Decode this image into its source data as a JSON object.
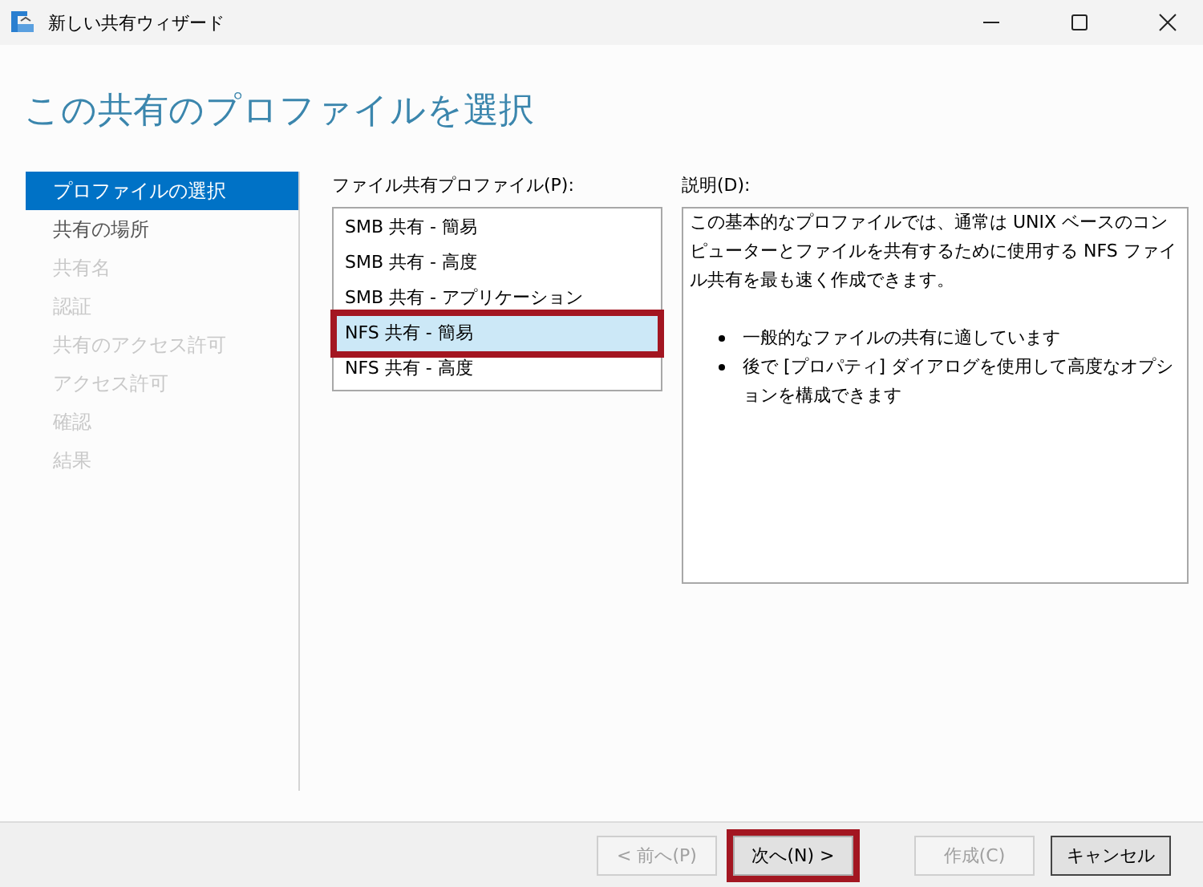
{
  "window": {
    "title": "新しい共有ウィザード"
  },
  "heading": "この共有のプロファイルを選択",
  "steps": [
    {
      "label": "プロファイルの選択",
      "selected": true,
      "disabled": false
    },
    {
      "label": "共有の場所",
      "selected": false,
      "disabled": false
    },
    {
      "label": "共有名",
      "selected": false,
      "disabled": true
    },
    {
      "label": "認証",
      "selected": false,
      "disabled": true
    },
    {
      "label": "共有のアクセス許可",
      "selected": false,
      "disabled": true
    },
    {
      "label": "アクセス許可",
      "selected": false,
      "disabled": true
    },
    {
      "label": "確認",
      "selected": false,
      "disabled": true
    },
    {
      "label": "結果",
      "selected": false,
      "disabled": true
    }
  ],
  "profiles": {
    "label": "ファイル共有プロファイル(P):",
    "items": [
      {
        "label": "SMB 共有 - 簡易",
        "selected": false,
        "highlighted": false
      },
      {
        "label": "SMB 共有 - 高度",
        "selected": false,
        "highlighted": false
      },
      {
        "label": "SMB 共有 - アプリケーション",
        "selected": false,
        "highlighted": false
      },
      {
        "label": "NFS 共有 - 簡易",
        "selected": true,
        "highlighted": true
      },
      {
        "label": "NFS 共有 - 高度",
        "selected": false,
        "highlighted": false
      }
    ]
  },
  "description": {
    "label": "説明(D):",
    "text": "この基本的なプロファイルでは、通常は UNIX ベースのコンピューターとファイルを共有するために使用する NFS ファイル共有を最も速く作成できます。",
    "bullets": [
      "一般的なファイルの共有に適しています",
      "後で [プロパティ] ダイアログを使用して高度なオプションを構成できます"
    ]
  },
  "buttons": [
    {
      "label": "< 前へ(P)",
      "disabled": true,
      "default": false,
      "highlighted": false
    },
    {
      "label": "次へ(N) >",
      "disabled": false,
      "default": false,
      "highlighted": true
    },
    {
      "label": "作成(C)",
      "disabled": true,
      "default": false,
      "highlighted": false
    },
    {
      "label": "キャンセル",
      "disabled": false,
      "default": true,
      "highlighted": false
    }
  ]
}
